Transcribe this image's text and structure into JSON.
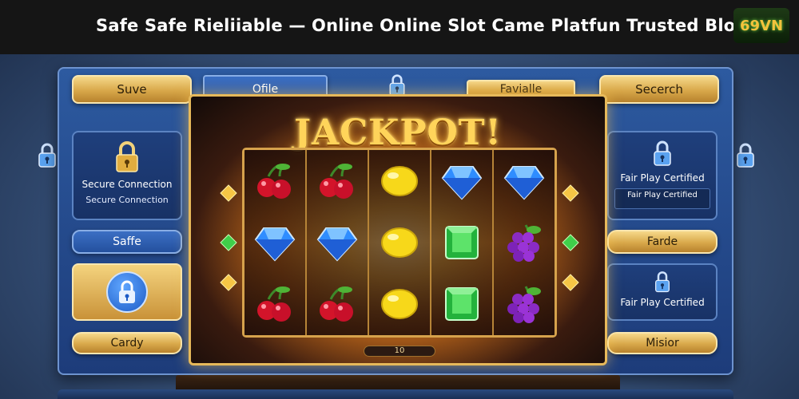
{
  "header": {
    "title": "Safe Safe Rieliiable — Online Online Slot Came Platfun Trusted Blog",
    "logo_text": "69VN"
  },
  "top_buttons": {
    "left": "Suve",
    "tab_left": "Ofile",
    "tab_right": "Favialle",
    "right": "Secerch"
  },
  "left_column": {
    "secure_card": {
      "label": "Secure Connection",
      "sublabel": "Secure Connection"
    },
    "safe_button": "Saffe",
    "cardy_button": "Cardy"
  },
  "right_column": {
    "fair_card_top": {
      "label": "Fair Play Certified",
      "box_text": "Fair Play Certified"
    },
    "farde_button": "Farde",
    "fair_card_bottom": {
      "label": "Fair Play Certified"
    },
    "misior_button": "Misior"
  },
  "game": {
    "banner": "JACKPOT!",
    "reels": [
      [
        "cherry",
        "blue-gem",
        "cherry"
      ],
      [
        "cherry",
        "blue-gem",
        "cherry"
      ],
      [
        "lemon",
        "lemon",
        "lemon"
      ],
      [
        "blue-gem",
        "green-gem",
        "green-gem"
      ],
      [
        "blue-gem",
        "grapes",
        "grapes"
      ]
    ],
    "counter": "10"
  },
  "colors": {
    "accent_gold": "#e7b95a",
    "panel_blue": "#2d5aa0",
    "topbar": "#151515"
  },
  "icons": [
    "lock-icon",
    "cherry-icon",
    "lemon-icon",
    "blue-gem-icon",
    "green-gem-icon",
    "grapes-icon"
  ]
}
